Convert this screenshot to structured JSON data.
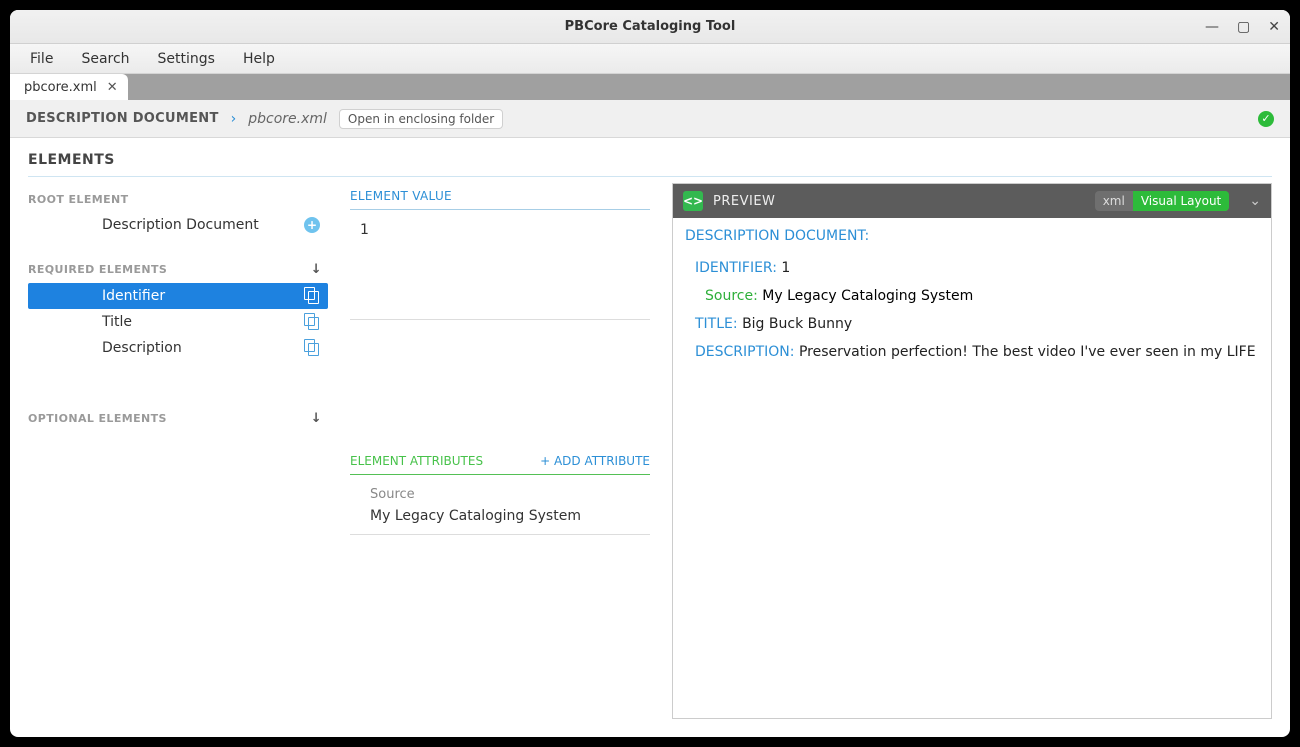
{
  "window": {
    "title": "PBCore Cataloging Tool"
  },
  "menu": {
    "file": "File",
    "search": "Search",
    "settings": "Settings",
    "help": "Help"
  },
  "tab": {
    "label": "pbcore.xml"
  },
  "breadcrumb": {
    "root": "DESCRIPTION DOCUMENT",
    "file": "pbcore.xml",
    "open": "Open in enclosing folder"
  },
  "page": {
    "heading": "ELEMENTS"
  },
  "left": {
    "root_label": "ROOT ELEMENT",
    "root_item": "Description Document",
    "required_label": "REQUIRED ELEMENTS",
    "required": [
      "Identifier",
      "Title",
      "Description"
    ],
    "optional_label": "OPTIONAL ELEMENTS"
  },
  "mid": {
    "value_label": "ELEMENT VALUE",
    "value": "1",
    "attr_label": "ELEMENT ATTRIBUTES",
    "add_attr": "+ ADD ATTRIBUTE",
    "attr_name": "Source",
    "attr_val": "My Legacy Cataloging System"
  },
  "preview": {
    "label": "PREVIEW",
    "toggle_xml": "xml",
    "toggle_visual": "Visual Layout",
    "root": "DESCRIPTION DOCUMENT:",
    "rows": {
      "identifier_k": "IDENTIFIER:",
      "identifier_v": "1",
      "source_k": "Source:",
      "source_v": "My Legacy Cataloging System",
      "title_k": "TITLE:",
      "title_v": "Big Buck Bunny",
      "desc_k": "DESCRIPTION:",
      "desc_v": "Preservation perfection! The best video I've ever seen in my LIFE"
    }
  }
}
